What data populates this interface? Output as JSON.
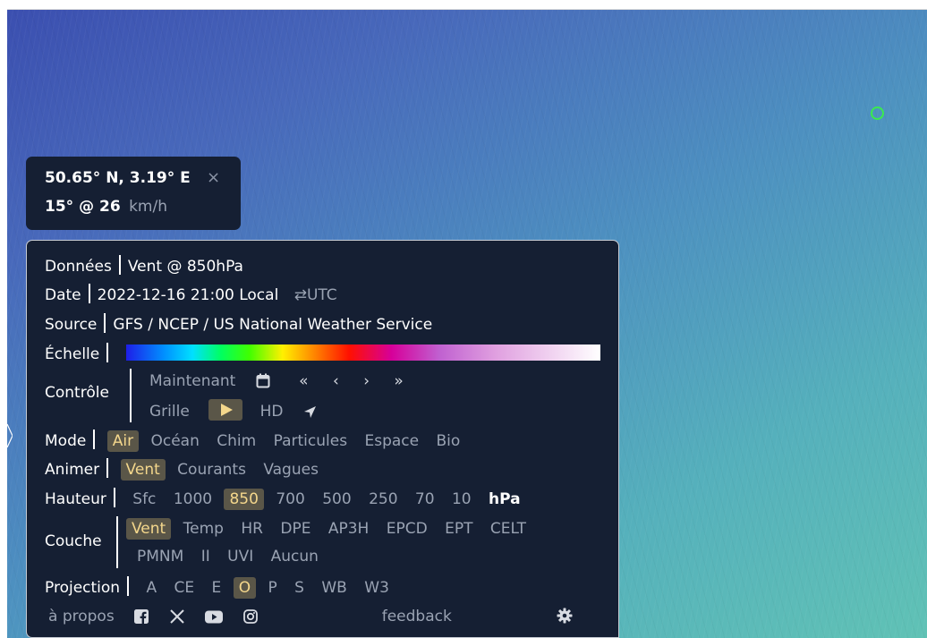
{
  "spotlight": {
    "coordinates": "50.65° N, 3.19° E",
    "close": "×",
    "value": "15° @ 26",
    "unit": "km/h"
  },
  "menu": {
    "data": {
      "label": "Données",
      "value": "Vent @ 850hPa"
    },
    "date": {
      "label": "Date",
      "value": "2022-12-16 21:00 Local",
      "toggle": "⇄UTC"
    },
    "source": {
      "label": "Source",
      "value": "GFS / NCEP / US National Weather Service"
    },
    "scale": {
      "label": "Échelle"
    },
    "control": {
      "label": "Contrôle",
      "now": "Maintenant",
      "calendar_icon": "calendar-icon",
      "nav": [
        "«",
        "‹",
        "›",
        "»"
      ],
      "grid": "Grille",
      "hd": "HD",
      "locate_icon": "location-arrow-icon"
    },
    "mode": {
      "label": "Mode",
      "options": [
        "Air",
        "Océan",
        "Chim",
        "Particules",
        "Espace",
        "Bio"
      ],
      "selected": "Air"
    },
    "animate": {
      "label": "Animer",
      "options": [
        "Vent",
        "Courants",
        "Vagues"
      ],
      "selected": "Vent"
    },
    "height": {
      "label": "Hauteur",
      "options": [
        "Sfc",
        "1000",
        "850",
        "700",
        "500",
        "250",
        "70",
        "10"
      ],
      "unit": "hPa",
      "selected": "850"
    },
    "overlay": {
      "label": "Couche",
      "row1": [
        "Vent",
        "Temp",
        "HR",
        "DPE",
        "AP3H",
        "EPCD",
        "EPT",
        "CELT"
      ],
      "row2": [
        "PMNM",
        "II",
        "UVI",
        "Aucun"
      ],
      "selected": "Vent"
    },
    "projection": {
      "label": "Projection",
      "options": [
        "A",
        "CE",
        "E",
        "O",
        "P",
        "S",
        "WB",
        "W3"
      ],
      "selected": "O"
    },
    "footer": {
      "about": "à propos",
      "feedback": "feedback"
    }
  },
  "colors": {
    "panel": "#151f33",
    "highlight_bg": "#5a5648",
    "highlight_text": "#f4d78c",
    "marker": "#3bea4f"
  }
}
